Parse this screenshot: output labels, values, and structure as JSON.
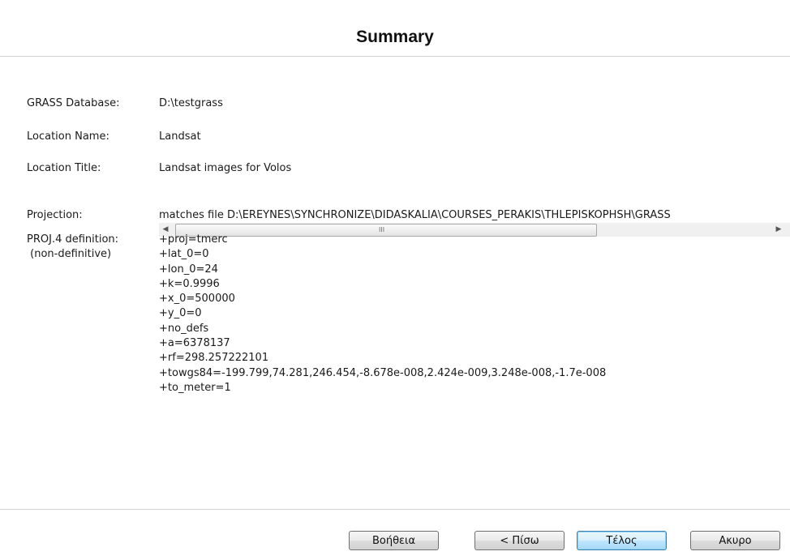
{
  "header": {
    "title": "Summary"
  },
  "summary": {
    "grass_database": {
      "label": "GRASS Database:",
      "value": "D:\\testgrass"
    },
    "location_name": {
      "label": "Location Name:",
      "value": "Landsat"
    },
    "location_title": {
      "label": "Location Title:",
      "value": "Landsat images for Volos"
    },
    "projection": {
      "label": "Projection:",
      "value": "matches file D:\\EREYNES\\SYNCHRONIZE\\DIDASKALIA\\COURSES_PERAKIS\\THLEPISKOPHSH\\GRASS"
    },
    "proj4": {
      "label": "PROJ.4 definition:\n (non-definitive)",
      "lines": [
        "+proj=tmerc",
        "+lat_0=0",
        "+lon_0=24",
        "+k=0.9996",
        "+x_0=500000",
        "+y_0=0",
        "+no_defs",
        "+a=6378137",
        "+rf=298.257222101",
        "+towgs84=-199.799,74.281,246.454,-8.678e-008,2.424e-009,3.248e-008,-1.7e-008",
        "+to_meter=1"
      ]
    }
  },
  "scrollbar": {
    "grip": "III"
  },
  "buttons": {
    "help": "Βοήθεια",
    "back": "< Πίσω",
    "finish": "Τέλος",
    "cancel": "Ακυρο"
  }
}
